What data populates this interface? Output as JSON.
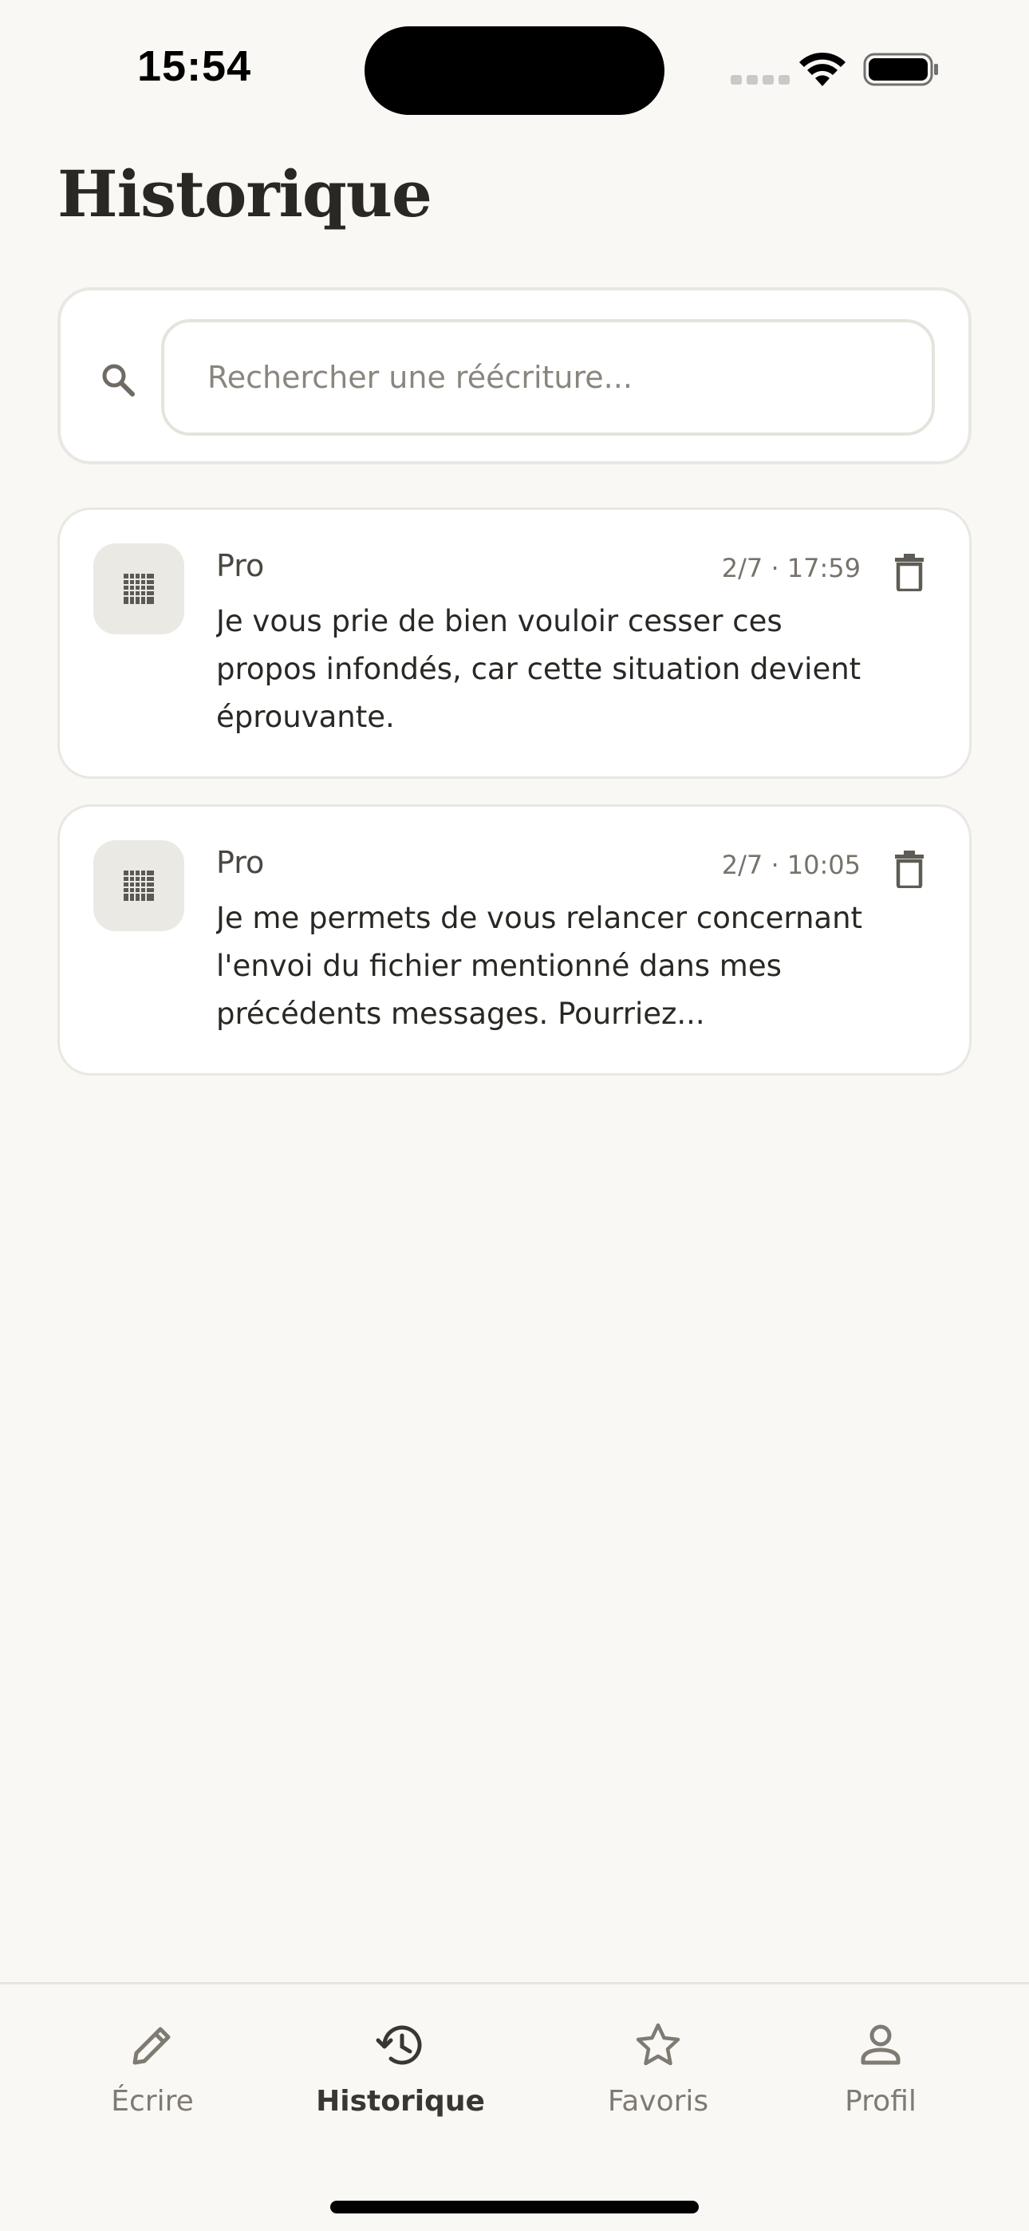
{
  "status_bar": {
    "time": "15:54"
  },
  "header": {
    "title": "Historique"
  },
  "search": {
    "placeholder": "Rechercher une réécriture..."
  },
  "history": [
    {
      "tag": "Pro",
      "date": "2/7 · 17:59",
      "text": "Je vous prie de bien vouloir cesser ces propos infondés, car cette situation devient éprouvante."
    },
    {
      "tag": "Pro",
      "date": "2/7 · 10:05",
      "text": "Je me permets de vous relancer concernant l'envoi du fichier mentionné dans mes précédents messages. Pourriez..."
    }
  ],
  "nav": {
    "write": "Écrire",
    "history": "Historique",
    "favorites": "Favoris",
    "profile": "Profil",
    "active": "history"
  },
  "colors": {
    "background": "#f9f8f5",
    "card": "#ffffff",
    "border": "#e9e7e1",
    "text": "#2a2824",
    "muted": "#77736b"
  }
}
